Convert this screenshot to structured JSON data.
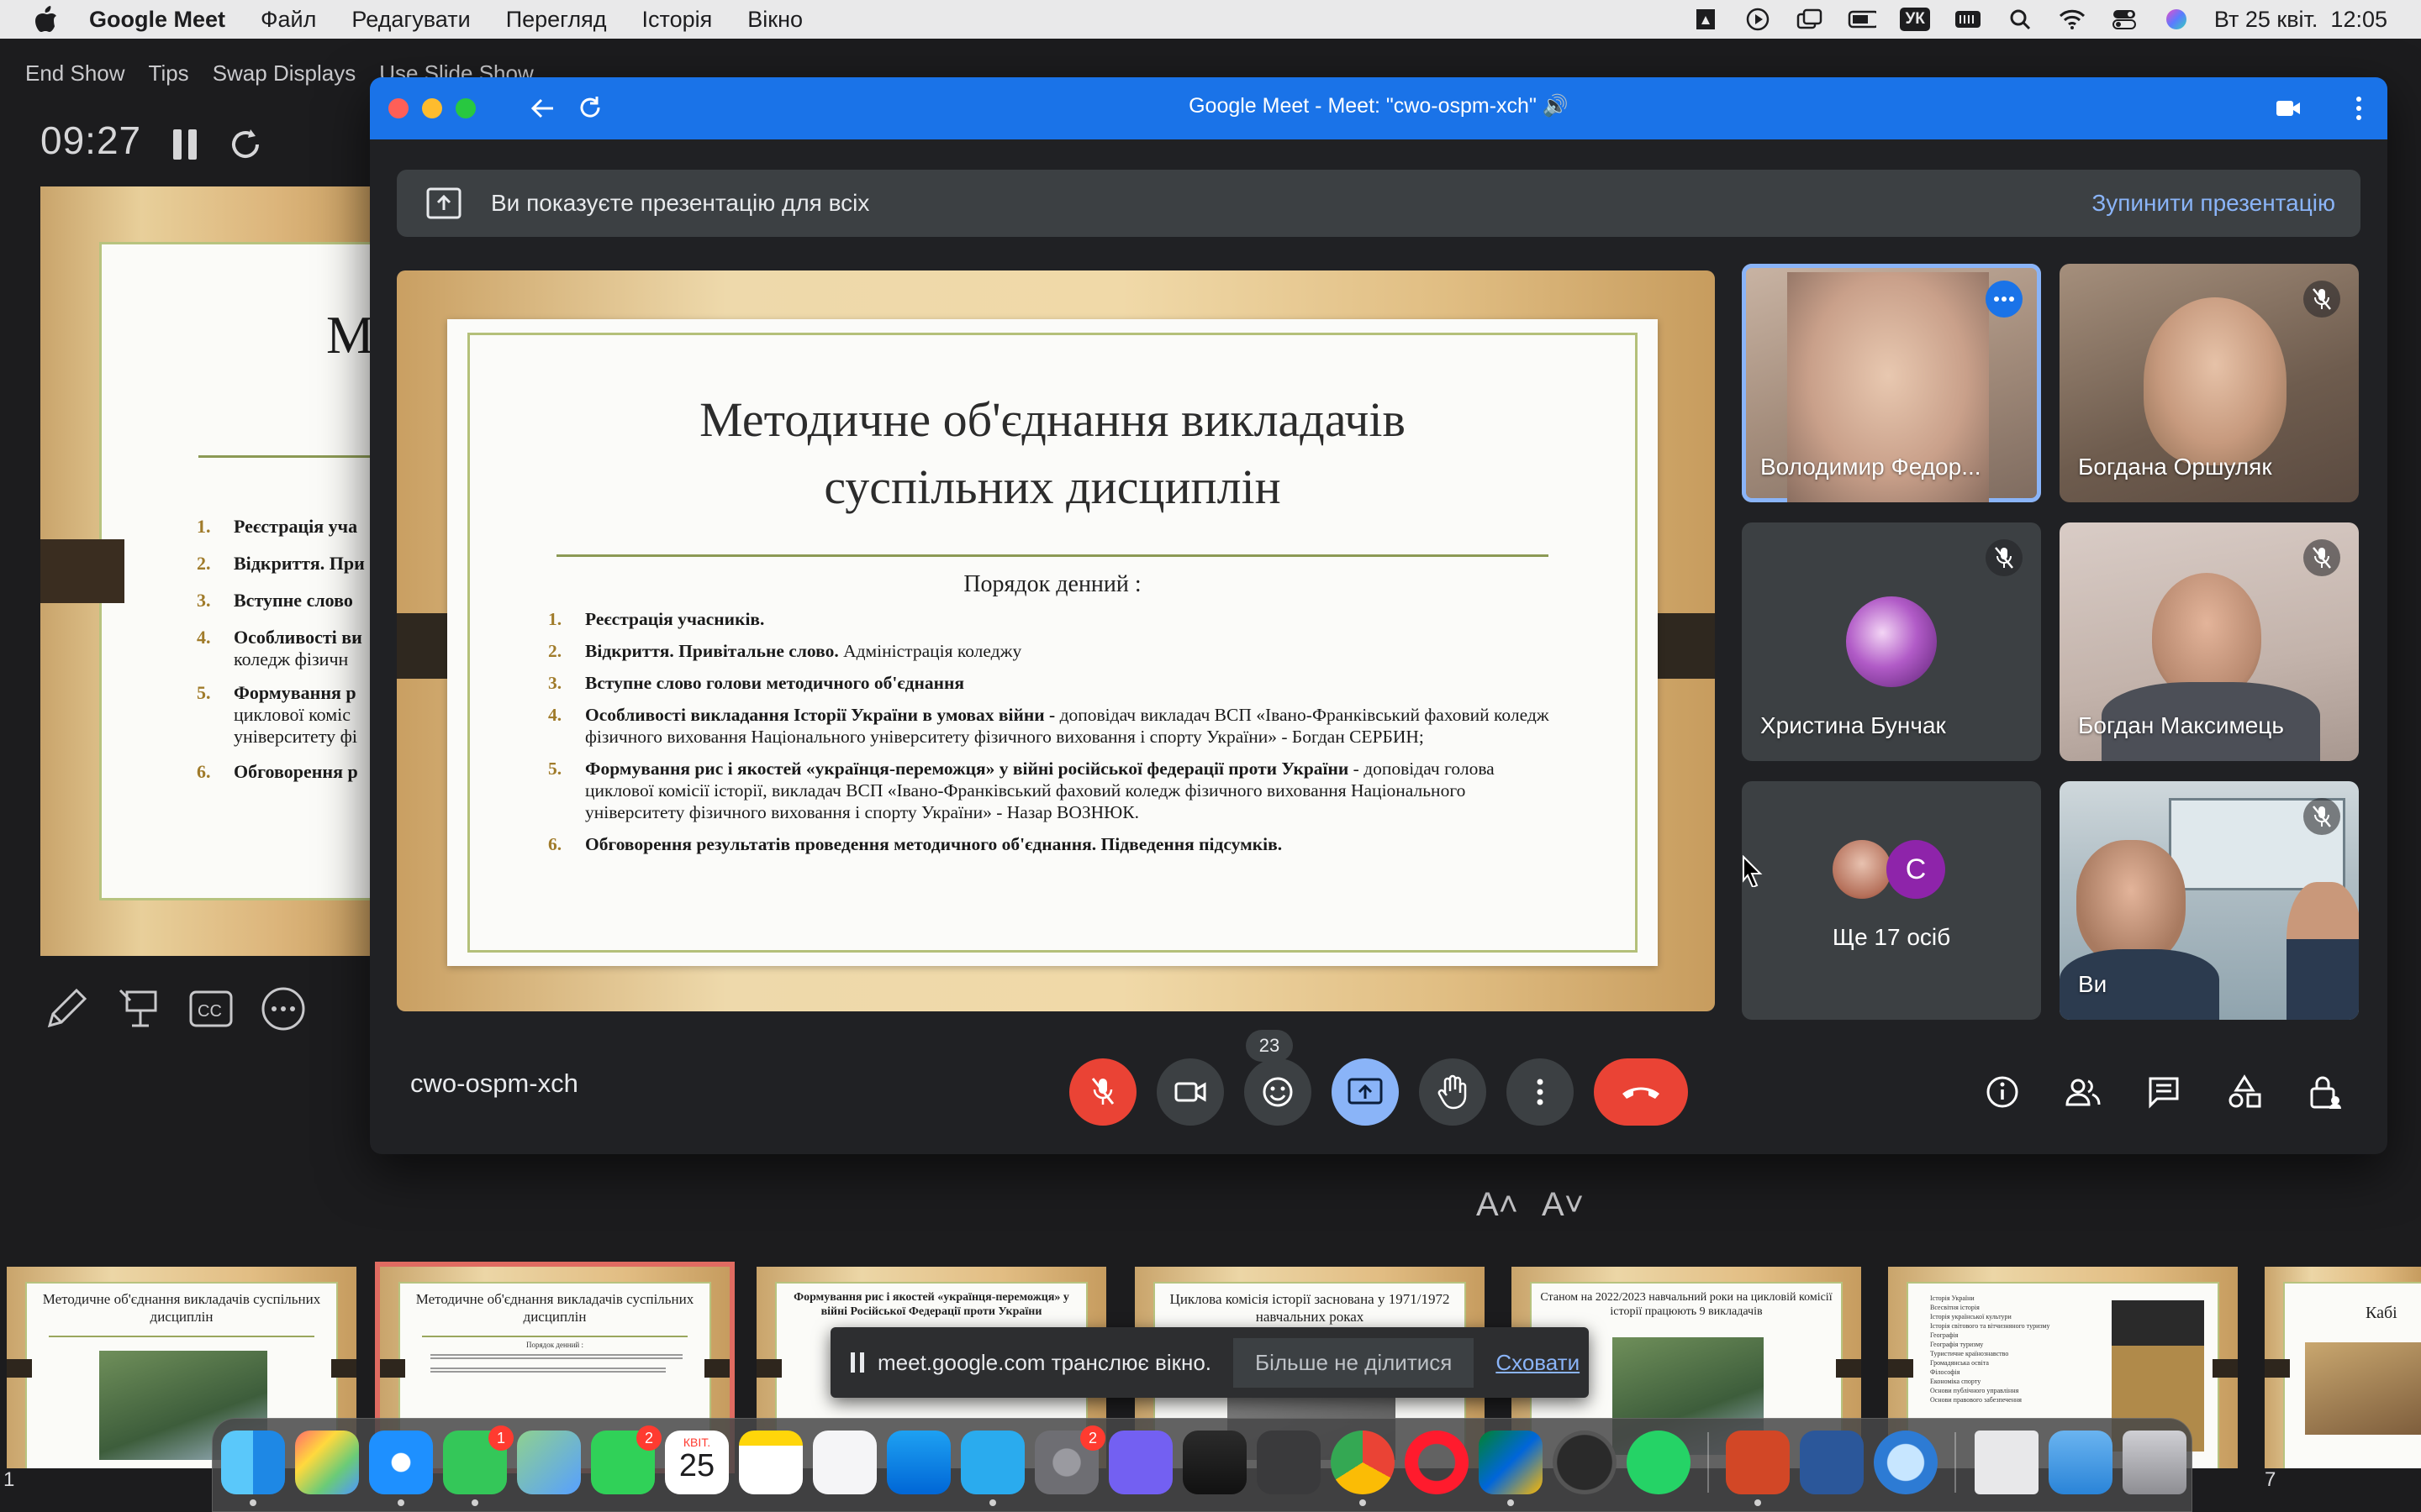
{
  "menubar": {
    "app_name": "Google Meet",
    "menus": [
      "Файл",
      "Редагувати",
      "Перегляд",
      "Історія",
      "Вікно"
    ],
    "keyboard_layout": "УК",
    "datetime": "Вт 25 квіт.  12:05"
  },
  "presenter": {
    "toolbar": [
      "End Show",
      "Tips",
      "Swap Displays",
      "Use Slide Show"
    ],
    "timer": "09:27",
    "bg_slide_title_fragment": "М",
    "bg_agenda": [
      "Реєстрація уча",
      "Відкриття. При",
      "Вступне слово",
      "Особливості ви",
      "коледж фізичн",
      "Формування р",
      "циклової коміс",
      "університету фі",
      "Обговорення р"
    ],
    "bg_agenda_nums": [
      "1.",
      "2.",
      "3.",
      "4.",
      "5.",
      "6."
    ]
  },
  "thumbnails": [
    {
      "title": "Методичне об'єднання викладачів суспільних дисциплін",
      "num": "1"
    },
    {
      "title": "Методичне об'єднання викладачів суспільних дисциплін",
      "sub": "Порядок денний :"
    },
    {
      "title": "Формування рис і якостей «українця-переможця» у війні Російської Федерації проти України"
    },
    {
      "title": "Циклова комісія історії заснована у 1971/1972 навчальних роках"
    },
    {
      "title": "Станом на 2022/2023 навчальний роки на цикловій комісії історії працюють 9 викладачів"
    },
    {
      "list": [
        "Історія України",
        "Всесвітня історія",
        "Історія української культури",
        "Історія світового та вітчизняного туризму",
        "Географія",
        "Географія туризму",
        "Туристичне країнознавство",
        "Громадянська освіта",
        "Філософія",
        "Економіка спорту",
        "Основи публічного управління",
        "Основи правового забезпечення"
      ]
    },
    {
      "title": "Кабі",
      "num": "7"
    }
  ],
  "meet": {
    "window_title": "Google Meet - Meet: \"cwo-ospm-xch\" 🔊",
    "share_banner": "Ви показуєте презентацію для всіх",
    "stop_presenting": "Зупинити презентацію",
    "slide": {
      "title_line1": "Методичне об'єднання викладачів",
      "title_line2": "суспільних дисциплін",
      "subtitle": "Порядок денний :",
      "items": [
        {
          "num": "1.",
          "bold": "Реєстрація учасників.",
          "rest": ""
        },
        {
          "num": "2.",
          "bold": "Відкриття. Привітальне слово.",
          "rest": " Адміністрація коледжу"
        },
        {
          "num": "3.",
          "bold": "Вступне слово голови методичного об'єднання",
          "rest": ""
        },
        {
          "num": "4.",
          "bold": "Особливості викладання Історії України в умовах війни  -",
          "rest": " доповідач викладач ВСП «Івано-Франківський фаховий коледж фізичного виховання Національного університету фізичного виховання і спорту України» - Богдан СЕРБИН;"
        },
        {
          "num": "5.",
          "bold": "Формування рис і якостей «українця-переможця» у війні російської федерації проти України",
          "rest": " - доповідач голова циклової комісії історії, викладач ВСП «Івано-Франківський фаховий коледж фізичного виховання Національного університету фізичного виховання і спорту України» - Назар ВОЗНЮК."
        },
        {
          "num": "6.",
          "bold": "Обговорення результатів проведення методичного об'єднання. Підведення підсумків.",
          "rest": ""
        }
      ]
    },
    "participants": [
      {
        "name": "Володимир Федор...",
        "muted": false
      },
      {
        "name": "Богдана Оршуляк",
        "muted": true
      },
      {
        "name": "Христина Бунчак",
        "muted": true
      },
      {
        "name": "Богдан Максимець",
        "muted": true
      },
      {
        "name": "Ще 17 осіб",
        "avatar_letter": "C"
      },
      {
        "name": "Ви",
        "muted": true
      }
    ],
    "meeting_code": "cwo-ospm-xch",
    "people_count": "23"
  },
  "toast": {
    "message": "meet.google.com транслює вікно.",
    "stop_sharing": "Більше не ділитися",
    "hide": "Сховати"
  },
  "dock": {
    "messages_badge": "1",
    "facetime_badge": "2",
    "settings_badge": "2",
    "calendar_month": "КВІТ.",
    "calendar_day": "25"
  },
  "colors": {
    "meet_blue": "#1a73e8",
    "meet_dark": "#202124",
    "red": "#ea4335",
    "link_blue": "#8ab4f8"
  }
}
